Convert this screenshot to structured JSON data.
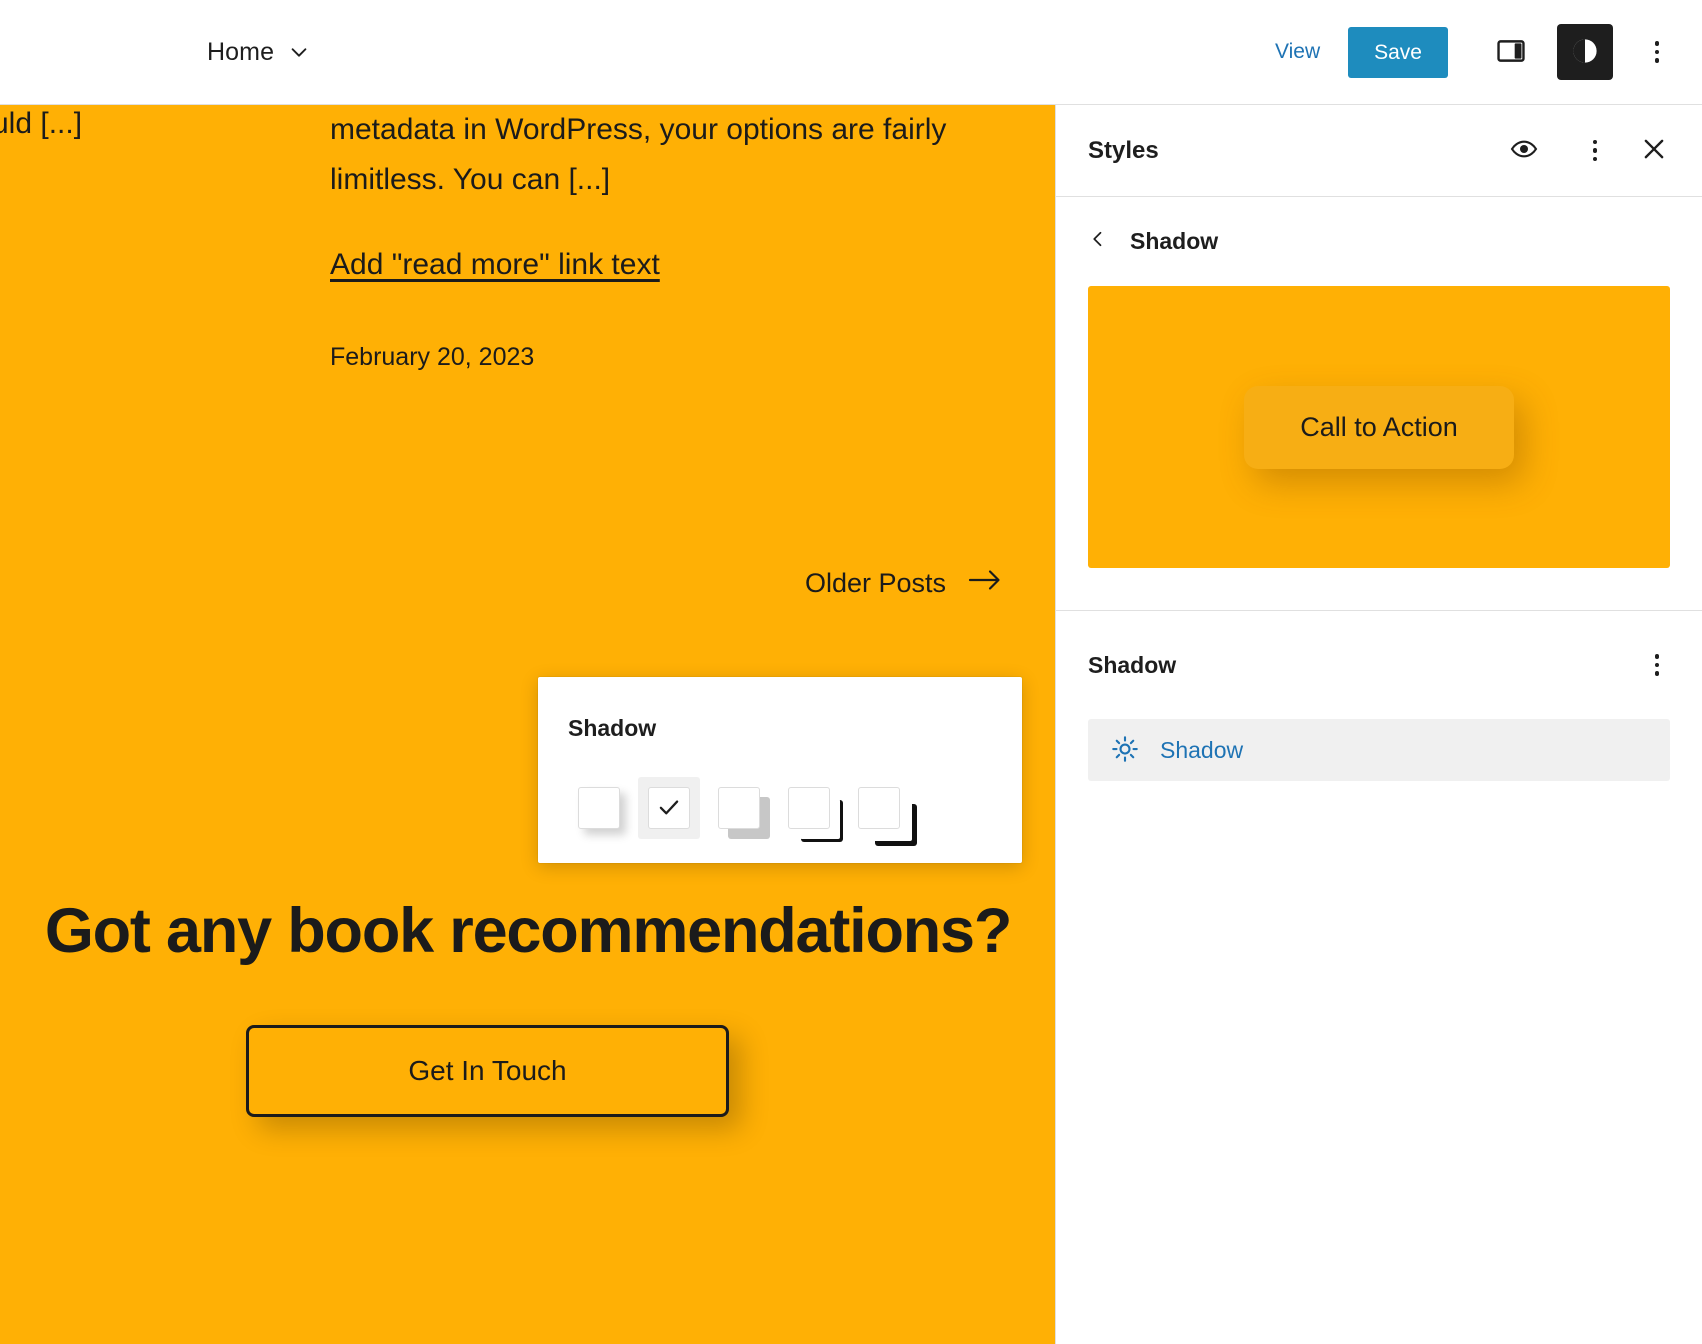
{
  "toolbar": {
    "document_title": "Home",
    "chevron_icon": "chevron-down-icon",
    "view_label": "View",
    "save_label": "Save",
    "sidebar_toggle_icon": "sidebar-panel-icon",
    "styles_toggle_icon": "styles-contrast-icon",
    "options_icon": "more-options-kebab-icon"
  },
  "canvas": {
    "excerpt_left_fragment": "uld [...]",
    "excerpt_text": "metadata in WordPress, your options are fairly limitless. You can [...]",
    "read_more_label": "Add \"read more\" link text",
    "post_date": "February 20, 2023",
    "older_posts_label": "Older Posts",
    "older_posts_icon": "arrow-right-icon",
    "cta_heading": "Got any book recommendations?",
    "cta_button_label": "Get In Touch",
    "background_color": "#FFB005",
    "text_color": "#1b1b1b"
  },
  "shadow_popover": {
    "title": "Shadow",
    "swatches": [
      {
        "name": "natural",
        "selected": false
      },
      {
        "name": "none",
        "selected": true
      },
      {
        "name": "deep",
        "selected": false
      },
      {
        "name": "sharp",
        "selected": false
      },
      {
        "name": "outlined",
        "selected": false
      }
    ],
    "check_icon": "checkmark-icon"
  },
  "sidebar": {
    "title": "Styles",
    "header_icons": {
      "preview": "eye-icon",
      "more": "more-options-kebab-icon",
      "close": "close-x-icon"
    },
    "back_nav": {
      "icon": "chevron-left-icon",
      "label": "Shadow"
    },
    "preview": {
      "button_label": "Call to Action",
      "background_color": "#FFB005"
    },
    "section": {
      "title": "Shadow",
      "more_icon": "more-options-kebab-icon"
    },
    "shadow_items": [
      {
        "icon": "shine-sun-icon",
        "label": "Shadow",
        "color": "#1e73b4"
      }
    ]
  }
}
